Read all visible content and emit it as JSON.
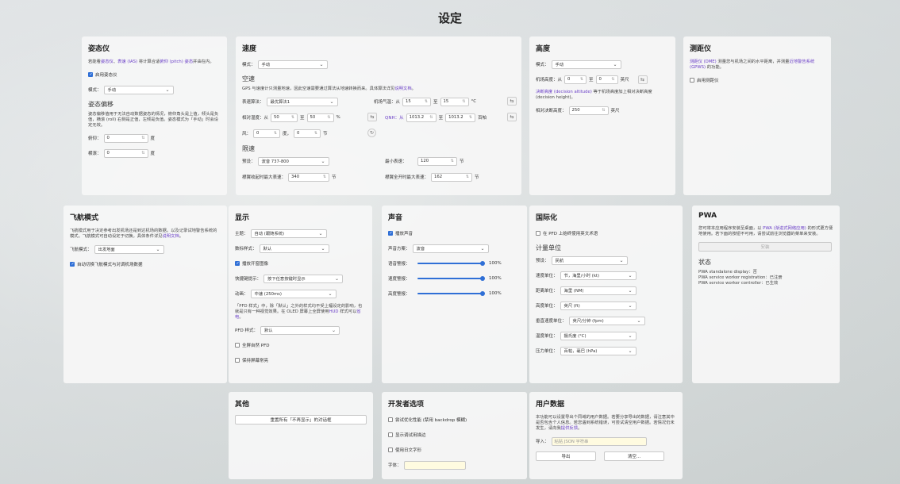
{
  "page": {
    "title": "设定"
  },
  "attitude": {
    "title": "姿态仪",
    "desc_pre": "若能看",
    "desc_link1": "姿态仪",
    "desc_sep1": "、",
    "desc_link2": "表速 (IAS)",
    "desc_mid": " 将计算合适",
    "desc_link3": "俯仰 (pitch) 姿态",
    "desc_post": "并由在内。",
    "enable_label": "启用姿态仪",
    "mode_label": "模式：",
    "mode_value": "手动",
    "offset_title": "姿态偏移",
    "offset_desc": "姿态偏移值用于无法自动数据姿态的情况，俯仰角头是上值，倾头是负值，横滚 (roll) 右侧是正值，左倾是负值。姿态模式为「手动」时会设定无效。",
    "pitch_label": "俯仰：",
    "pitch_value": "0",
    "roll_label": "横滚：",
    "roll_value": "0",
    "unit": "度"
  },
  "speed": {
    "title": "速度",
    "mode_label": "模式：",
    "mode_value": "手动",
    "airspeed_title": "空速",
    "airspeed_desc_pre": "GPS 与速度计只测量地速，因此空速需要通过算法从地速转换而来。具体算法详见",
    "airspeed_desc_link": "说明文档",
    "airspeed_desc_post": "。",
    "algo_label": "表速算法：",
    "algo_value": "最优算法1",
    "temp_label": "机场气温：从",
    "temp_from": "15",
    "temp_to_label": "至",
    "temp_to": "15",
    "temp_unit": "°C",
    "rh_label": "相对湿度：从",
    "rh_from": "50",
    "rh_to_label": "至",
    "rh_to": "50",
    "rh_unit": "%",
    "qnh_label": "QNH：从",
    "qnh_from": "1013.2",
    "qnh_to_label": "至",
    "qnh_to": "1013.2",
    "qnh_unit": "百帕",
    "wind_label": "风：",
    "wind_dir": "0",
    "wind_dir_unit": "度，",
    "wind_speed": "0",
    "wind_speed_unit": "节",
    "limit_title": "限速",
    "model_label": "预设：",
    "model_value": "波音 737-800",
    "min_label": "最小表速：",
    "min_value": "120",
    "kt": "节",
    "vfe_label": "襟翼收起时最大表速：",
    "vfe_value": "340",
    "vle_label": "襟翼全开时最大表速：",
    "vle_value": "162"
  },
  "altitude": {
    "title": "高度",
    "mode_label": "模式：",
    "mode_value": "手动",
    "elev_label": "机场高度：从",
    "elev_from": "0",
    "elev_to_label": "至",
    "elev_to": "0",
    "elev_unit": "英尺",
    "dh_link": "决断高度 (decision altitude)",
    "dh_desc": " 等于机场高度加上相对决断高度 (decision height)。",
    "rdh_label": "相对决断高度：",
    "rdh_value": "250",
    "rdh_unit": "英尺"
  },
  "dme": {
    "title": "测距仪",
    "desc_link1": "测距仪 (DME)",
    "desc_mid": " 测量您与机场之间的水平距离，并测量",
    "desc_link2": "近地警告系统 (GPWS)",
    "desc_post": " 的功能。",
    "enable_label": "启用测距仪"
  },
  "flight_mode": {
    "title": "飞航模式",
    "desc_pre": "飞航模式用于决定参考出发机场还是到达机场的数据。以及记录试地警告系统的模式。飞航模式可自动设定于切换。具体条件详见",
    "desc_link": "说明文档",
    "desc_post": "。",
    "mode_label": "飞航模式：",
    "mode_value": "出发地面",
    "auto_label": "自动切换飞航模式与对调机场数据"
  },
  "display": {
    "title": "显示",
    "theme_label": "主题：",
    "theme_value": "自动 (跟随系统)",
    "font_label": "数标样式：",
    "font_value": "默认",
    "show_pictures_label": "播放开窗图像",
    "shortcut_label": "快捷键提示：",
    "shortcut_value": "按下任意按键时显示",
    "anim_label": "动画：",
    "anim_value": "中速 (250ms)",
    "pfd_desc_pre": "「PFD 样式」中，除「默认」之外的样式均不受上幅设定的影响，也就是只有一种视觉效果。在 OLED 屏幕上全屏使用",
    "pfd_desc_link1": "HUD",
    "pfd_desc_mid": " 样式可以",
    "pfd_desc_link2": "省电",
    "pfd_desc_post": "。",
    "pfd_label": "PFD 样式：",
    "pfd_value": "默认",
    "fullscreen_label": "全屏自然 PFD",
    "keep_awake_label": "保持屏幕常亮"
  },
  "sound": {
    "title": "声音",
    "enable_label": "播放声音",
    "scheme_label": "声音方案：",
    "scheme_value": "波音",
    "vol1_label": "语音警报：",
    "vol1_value": "100%",
    "vol2_label": "速度警报：",
    "vol2_value": "100%",
    "vol3_label": "高度警报：",
    "vol3_value": "100%"
  },
  "i18n": {
    "title": "国际化",
    "english_label": "在 PFD 上始终使用英文术语",
    "units_title": "计量单位",
    "preset_label": "预设：",
    "preset_value": "民航",
    "speed_unit_label": "速度单位：",
    "speed_unit_value": "节，海里/小时 (kt)",
    "dist_unit_label": "距离单位：",
    "dist_unit_value": "海里 (NM)",
    "alt_unit_label": "高度单位：",
    "alt_unit_value": "英尺 (ft)",
    "vs_unit_label": "垂直速度单位：",
    "vs_unit_value": "英尺/分钟 (fpm)",
    "temp_unit_label": "温度单位：",
    "temp_unit_value": "摄氏度 (°C)",
    "press_unit_label": "压力单位：",
    "press_unit_value": "百帕，毫巴 (hPa)"
  },
  "pwa": {
    "title": "PWA",
    "desc_pre": "您可将本应用程序安装至桌面，以 ",
    "desc_link": "PWA (渐进式网络应用)",
    "desc_post": " 的形式更方便地使用。若下面的按钮不可用，请尝试前往浏览器的菜单来安装。",
    "install_label": "安装",
    "status_title": "状态",
    "s1": "PWA standalone display：否",
    "s2": "PWA service worker registration：已注册",
    "s3": "PWA service worker controller：已生效"
  },
  "other": {
    "title": "其他",
    "reset_label": "重置所有「不再显示」的对话框"
  },
  "dev": {
    "title": "开发者选项",
    "opt1_label": "尝试优化性能 (禁用 backdrop 模糊)",
    "opt2_label": "显示调试用描边",
    "opt3_label": "使用日文字形",
    "font_label": "字体："
  },
  "user_data": {
    "title": "用户数据",
    "desc_pre": "本功能可以设置导出个同域的用户数据。若要分享导出的数据，请注意其中是否包含个人信息。若您遇到系统错误，可尝试清空用户数据。若情况仍未发生，请向我",
    "desc_link": "提供反馈",
    "desc_post": "。",
    "import_label": "导入：",
    "import_placeholder": "粘贴 JSON 字符串",
    "export_label": "导出",
    "clear_label": "清空..."
  }
}
